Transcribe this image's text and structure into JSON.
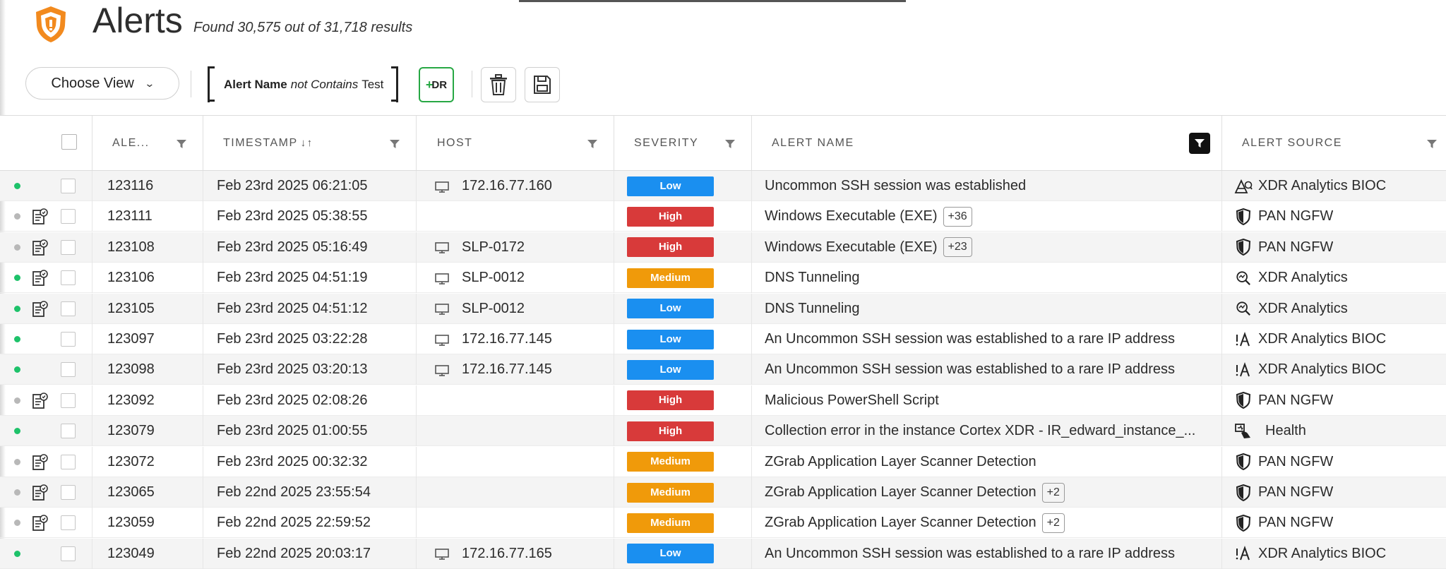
{
  "header": {
    "title": "Alerts",
    "results_text": "Found 30,575 out of 31,718 results"
  },
  "toolbar": {
    "choose_view_label": "Choose View",
    "filter_field": "Alert Name",
    "filter_operator": "not Contains",
    "filter_value": "Test",
    "xdr_button_label": "DR",
    "xdr_button_plus": "+"
  },
  "columns": {
    "alert_id": "ALE...",
    "timestamp": "TIMESTAMP",
    "timestamp_sort": "↓↑",
    "host": "HOST",
    "severity": "SEVERITY",
    "alert_name": "ALERT NAME",
    "alert_source": "ALERT SOURCE"
  },
  "colors": {
    "low": "#1a8ff0",
    "medium": "#f09a0a",
    "high": "#d83a3a",
    "status_green": "#1ec26a",
    "status_gray": "#b8b8b8",
    "xdr_green": "#27a844",
    "logo_orange": "#f28a1e"
  },
  "rows": [
    {
      "status": "green",
      "note": false,
      "id": "123116",
      "timestamp": "Feb 23rd 2025 06:21:05",
      "host": "172.16.77.160",
      "severity": "Low",
      "sev_key": "low",
      "alert_name": "Uncommon SSH session was established",
      "badge": "",
      "source": "XDR Analytics BIOC",
      "source_icon": "analytics-bioc-icon"
    },
    {
      "status": "gray",
      "note": true,
      "id": "123111",
      "timestamp": "Feb 23rd 2025 05:38:55",
      "host": "",
      "severity": "High",
      "sev_key": "high",
      "alert_name": "Windows Executable (EXE)",
      "badge": "+36",
      "source": "PAN NGFW",
      "source_icon": "shield-icon"
    },
    {
      "status": "gray",
      "note": true,
      "id": "123108",
      "timestamp": "Feb 23rd 2025 05:16:49",
      "host": "SLP-0172",
      "severity": "High",
      "sev_key": "high",
      "alert_name": "Windows Executable (EXE)",
      "badge": "+23",
      "source": "PAN NGFW",
      "source_icon": "shield-icon"
    },
    {
      "status": "green",
      "note": true,
      "id": "123106",
      "timestamp": "Feb 23rd 2025 04:51:19",
      "host": "SLP-0012",
      "severity": "Medium",
      "sev_key": "medium",
      "alert_name": "DNS Tunneling",
      "badge": "",
      "source": "XDR Analytics",
      "source_icon": "analytics-icon"
    },
    {
      "status": "green",
      "note": true,
      "id": "123105",
      "timestamp": "Feb 23rd 2025 04:51:12",
      "host": "SLP-0012",
      "severity": "Low",
      "sev_key": "low",
      "alert_name": "DNS Tunneling",
      "badge": "",
      "source": "XDR Analytics",
      "source_icon": "analytics-icon"
    },
    {
      "status": "green",
      "note": false,
      "id": "123097",
      "timestamp": "Feb 23rd 2025 03:22:28",
      "host": "172.16.77.145",
      "severity": "Low",
      "sev_key": "low",
      "alert_name": "An Uncommon SSH session was established to a rare IP address",
      "badge": "",
      "source": "XDR Analytics BIOC",
      "source_icon": "bioc-icon"
    },
    {
      "status": "green",
      "note": false,
      "id": "123098",
      "timestamp": "Feb 23rd 2025 03:20:13",
      "host": "172.16.77.145",
      "severity": "Low",
      "sev_key": "low",
      "alert_name": "An Uncommon SSH session was established to a rare IP address",
      "badge": "",
      "source": "XDR Analytics BIOC",
      "source_icon": "bioc-icon"
    },
    {
      "status": "gray",
      "note": true,
      "id": "123092",
      "timestamp": "Feb 23rd 2025 02:08:26",
      "host": "",
      "severity": "High",
      "sev_key": "high",
      "alert_name": "Malicious PowerShell Script",
      "badge": "",
      "source": "PAN NGFW",
      "source_icon": "shield-icon"
    },
    {
      "status": "green",
      "note": false,
      "id": "123079",
      "timestamp": "Feb 23rd 2025 01:00:55",
      "host": "",
      "severity": "High",
      "sev_key": "high",
      "alert_name": "Collection error in the instance Cortex XDR - IR_edward_instance_...",
      "badge": "",
      "source": "Health",
      "source_icon": "health-icon"
    },
    {
      "status": "gray",
      "note": true,
      "id": "123072",
      "timestamp": "Feb 23rd 2025 00:32:32",
      "host": "",
      "severity": "Medium",
      "sev_key": "medium",
      "alert_name": "ZGrab Application Layer Scanner Detection",
      "badge": "",
      "source": "PAN NGFW",
      "source_icon": "shield-icon"
    },
    {
      "status": "gray",
      "note": true,
      "id": "123065",
      "timestamp": "Feb 22nd 2025 23:55:54",
      "host": "",
      "severity": "Medium",
      "sev_key": "medium",
      "alert_name": "ZGrab Application Layer Scanner Detection",
      "badge": "+2",
      "source": "PAN NGFW",
      "source_icon": "shield-icon"
    },
    {
      "status": "gray",
      "note": true,
      "id": "123059",
      "timestamp": "Feb 22nd 2025 22:59:52",
      "host": "",
      "severity": "Medium",
      "sev_key": "medium",
      "alert_name": "ZGrab Application Layer Scanner Detection",
      "badge": "+2",
      "source": "PAN NGFW",
      "source_icon": "shield-icon"
    },
    {
      "status": "green",
      "note": false,
      "id": "123049",
      "timestamp": "Feb 22nd 2025 20:03:17",
      "host": "172.16.77.165",
      "severity": "Low",
      "sev_key": "low",
      "alert_name": "An Uncommon SSH session was established to a rare IP address",
      "badge": "",
      "source": "XDR Analytics BIOC",
      "source_icon": "bioc-icon"
    }
  ]
}
